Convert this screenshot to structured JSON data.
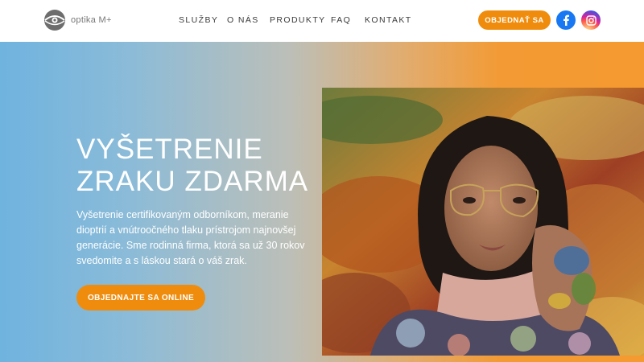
{
  "brand": {
    "name": "optika M+"
  },
  "nav": {
    "items": [
      {
        "label": "SLUŽBY"
      },
      {
        "label": "O NÁS"
      },
      {
        "label": "PRODUKTY"
      },
      {
        "label": "FAQ"
      },
      {
        "label": "KONTAKT"
      }
    ]
  },
  "header": {
    "cta_label": "OBJEDNAŤ SA",
    "social": [
      {
        "icon": "facebook-icon",
        "color": "#1877f2"
      },
      {
        "icon": "instagram-icon",
        "color": "#d6249f"
      }
    ]
  },
  "hero": {
    "title_line1": "VYŠETRENIE",
    "title_line2": "ZRAKU ZDARMA",
    "text": "Vyšetrenie certifikovaným odborníkom, meranie dioptrií a vnútroočného tlaku prístrojom najnovšej generácie. Sme rodinná firma, ktorá sa už 30 rokov svedomite a s láskou stará o váš zrak.",
    "cta_label": "OBJEDNAJTE SA ONLINE"
  },
  "colors": {
    "accent": "#f08c0d",
    "gradient_start": "#6fb3df",
    "gradient_end": "#f59a30"
  }
}
